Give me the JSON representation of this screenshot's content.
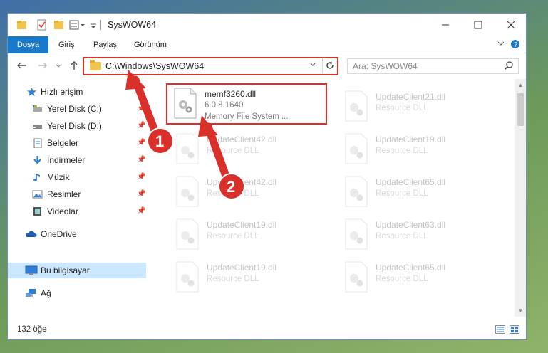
{
  "window": {
    "title": "SysWOW64"
  },
  "ribbon": {
    "tabs": [
      {
        "label": "Dosya",
        "active": true
      },
      {
        "label": "Giriş"
      },
      {
        "label": "Paylaş"
      },
      {
        "label": "Görünüm"
      }
    ]
  },
  "address": {
    "path": "C:\\Windows\\SysWOW64",
    "search_placeholder": "Ara: SysWOW64"
  },
  "nav": {
    "items": [
      {
        "label": "Hızlı erişim",
        "icon": "star-icon"
      },
      {
        "label": "Yerel Disk (C:)",
        "icon": "drive-icon",
        "pinned": true
      },
      {
        "label": "Yerel Disk (D:)",
        "icon": "drive-icon",
        "pinned": true
      },
      {
        "label": "Belgeler",
        "icon": "document-icon",
        "pinned": true
      },
      {
        "label": "İndirmeler",
        "icon": "download-icon",
        "pinned": true
      },
      {
        "label": "Müzik",
        "icon": "music-icon",
        "pinned": true
      },
      {
        "label": "Resimler",
        "icon": "pictures-icon",
        "pinned": true
      },
      {
        "label": "Videolar",
        "icon": "video-icon",
        "pinned": true
      },
      {
        "label": "OneDrive",
        "icon": "cloud-icon"
      },
      {
        "label": "Bu bilgisayar",
        "icon": "computer-icon",
        "selected": true
      },
      {
        "label": "Ağ",
        "icon": "network-icon"
      }
    ]
  },
  "files": [
    {
      "name": "memf3260.dll",
      "version": "6.0.8.1640",
      "desc": "Memory File System ...",
      "highlight": true
    },
    {
      "name": "UpdateClient21.dll",
      "version": "Resource DLL"
    },
    {
      "name": "UpdateClient42.dll",
      "version": "Resource DLL"
    },
    {
      "name": "UpdateClient19.dll",
      "version": "Resource DLL"
    },
    {
      "name": "UpdateClient42.dll",
      "version": "Resource DLL"
    },
    {
      "name": "UpdateClient65.dll",
      "version": "Resource DLL"
    },
    {
      "name": "UpdateClient19.dll",
      "version": "Resource DLL"
    },
    {
      "name": "UpdateClient63.dll",
      "version": "Resource DLL"
    },
    {
      "name": "UpdateClient19.dll",
      "version": "Resource DLL"
    },
    {
      "name": "UpdateClient65.dll",
      "version": "Resource DLL"
    }
  ],
  "status": {
    "count": "132 öğe"
  },
  "annotations": {
    "badges": [
      "1",
      "2"
    ],
    "color": "#d9302c"
  },
  "colors": {
    "accent": "#1979ca",
    "highlight": "#d9302c",
    "selection": "#cce8ff"
  }
}
